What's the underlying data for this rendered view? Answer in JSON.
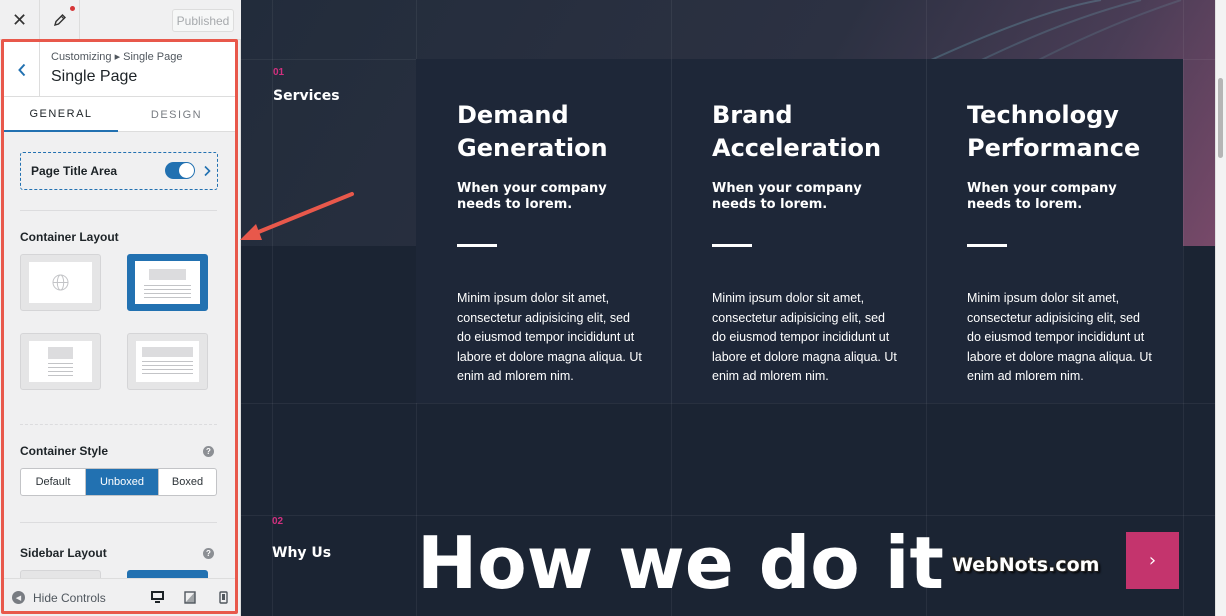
{
  "customizer": {
    "close_icon": "close-icon",
    "edit_icon": "pencil-icon",
    "publish_label": "Published",
    "breadcrumb": "Customizing ▸ Single Page",
    "section_title": "Single Page",
    "tabs": [
      {
        "label": "GENERAL",
        "active": true
      },
      {
        "label": "DESIGN",
        "active": false
      }
    ],
    "page_title_area": {
      "label": "Page Title Area",
      "enabled": true
    },
    "container_layout": {
      "label": "Container Layout",
      "selected_index": 1
    },
    "container_style": {
      "label": "Container Style",
      "options": [
        "Default",
        "Unboxed",
        "Boxed"
      ],
      "selected": "Unboxed"
    },
    "sidebar_layout": {
      "label": "Sidebar Layout"
    },
    "footer": {
      "hide_controls_label": "Hide Controls",
      "devices": [
        "desktop-icon",
        "tablet-icon",
        "mobile-icon"
      ]
    },
    "colors": {
      "accent": "#2271b1",
      "highlight_frame": "#e8584b"
    }
  },
  "preview": {
    "section1": {
      "number": "01",
      "title": "Services"
    },
    "cards": [
      {
        "title": "Demand\nGeneration",
        "subtitle": "When your company needs to lorem.",
        "body": "Minim ipsum dolor sit amet, consectetur adipisicing elit, sed do eiusmod tempor incididunt ut labore et dolore magna aliqua. Ut enim ad mlorem nim."
      },
      {
        "title": "Brand\nAcceleration",
        "subtitle": "When your company needs to lorem.",
        "body": "Minim ipsum dolor sit amet, consectetur adipisicing elit, sed do eiusmod tempor incididunt ut labore et dolore magna aliqua. Ut enim ad mlorem nim."
      },
      {
        "title": "Technology\nPerformance",
        "subtitle": "When your company needs to lorem.",
        "body": "Minim ipsum dolor sit amet, consectetur adipisicing elit, sed do eiusmod tempor incididunt ut labore et dolore magna aliqua. Ut enim ad mlorem nim."
      }
    ],
    "section2": {
      "number": "02",
      "title": "Why Us"
    },
    "big_heading": "How we do it",
    "watermark": "WebNots.com",
    "next_icon": "chevron-right-icon",
    "colors": {
      "accent_pink": "#d1307f",
      "button": "#c4346d",
      "background": "#1b2433"
    }
  }
}
